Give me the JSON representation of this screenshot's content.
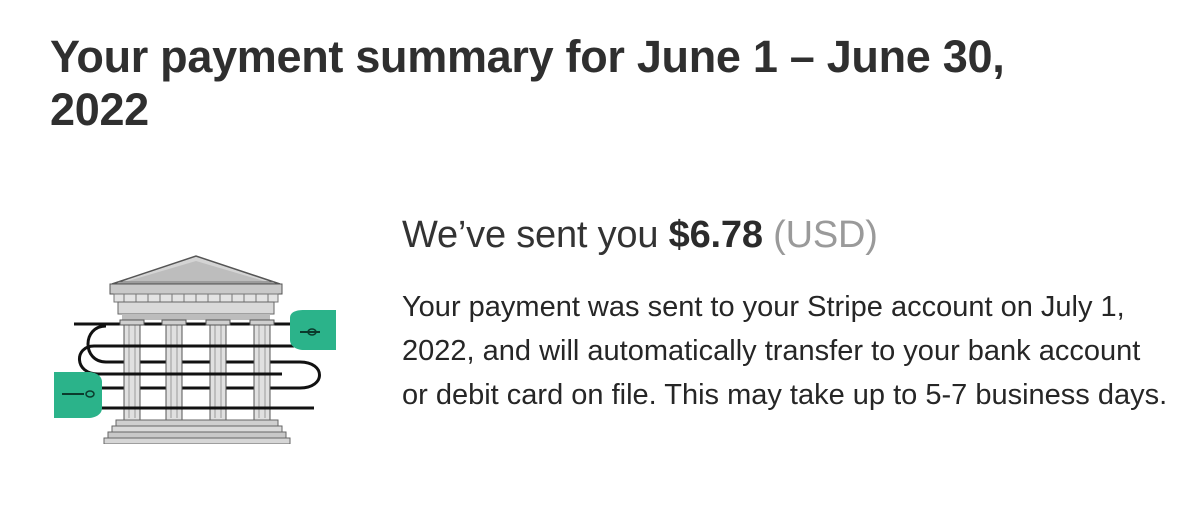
{
  "summary": {
    "title": "Your payment summary for June 1 – June 30, 2022"
  },
  "payment": {
    "sent_prefix": "We’ve sent you",
    "amount": "$6.78",
    "currency": "(USD)",
    "description": "Your payment was sent to your Stripe account on July 1, 2022, and will automatically transfer to your bank account or debit card on file. This may take up to 5-7 business days."
  },
  "illustration": {
    "icon": "bank-building-icon",
    "accent_color": "#2bb38a"
  }
}
